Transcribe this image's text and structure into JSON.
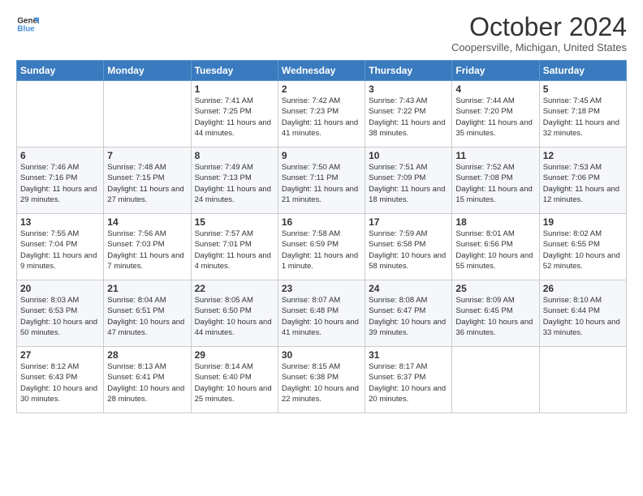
{
  "logo": {
    "line1": "General",
    "line2": "Blue"
  },
  "title": "October 2024",
  "location": "Coopersville, Michigan, United States",
  "days_of_week": [
    "Sunday",
    "Monday",
    "Tuesday",
    "Wednesday",
    "Thursday",
    "Friday",
    "Saturday"
  ],
  "weeks": [
    [
      {
        "day": "",
        "sunrise": "",
        "sunset": "",
        "daylight": ""
      },
      {
        "day": "",
        "sunrise": "",
        "sunset": "",
        "daylight": ""
      },
      {
        "day": "1",
        "sunrise": "Sunrise: 7:41 AM",
        "sunset": "Sunset: 7:25 PM",
        "daylight": "Daylight: 11 hours and 44 minutes."
      },
      {
        "day": "2",
        "sunrise": "Sunrise: 7:42 AM",
        "sunset": "Sunset: 7:23 PM",
        "daylight": "Daylight: 11 hours and 41 minutes."
      },
      {
        "day": "3",
        "sunrise": "Sunrise: 7:43 AM",
        "sunset": "Sunset: 7:22 PM",
        "daylight": "Daylight: 11 hours and 38 minutes."
      },
      {
        "day": "4",
        "sunrise": "Sunrise: 7:44 AM",
        "sunset": "Sunset: 7:20 PM",
        "daylight": "Daylight: 11 hours and 35 minutes."
      },
      {
        "day": "5",
        "sunrise": "Sunrise: 7:45 AM",
        "sunset": "Sunset: 7:18 PM",
        "daylight": "Daylight: 11 hours and 32 minutes."
      }
    ],
    [
      {
        "day": "6",
        "sunrise": "Sunrise: 7:46 AM",
        "sunset": "Sunset: 7:16 PM",
        "daylight": "Daylight: 11 hours and 29 minutes."
      },
      {
        "day": "7",
        "sunrise": "Sunrise: 7:48 AM",
        "sunset": "Sunset: 7:15 PM",
        "daylight": "Daylight: 11 hours and 27 minutes."
      },
      {
        "day": "8",
        "sunrise": "Sunrise: 7:49 AM",
        "sunset": "Sunset: 7:13 PM",
        "daylight": "Daylight: 11 hours and 24 minutes."
      },
      {
        "day": "9",
        "sunrise": "Sunrise: 7:50 AM",
        "sunset": "Sunset: 7:11 PM",
        "daylight": "Daylight: 11 hours and 21 minutes."
      },
      {
        "day": "10",
        "sunrise": "Sunrise: 7:51 AM",
        "sunset": "Sunset: 7:09 PM",
        "daylight": "Daylight: 11 hours and 18 minutes."
      },
      {
        "day": "11",
        "sunrise": "Sunrise: 7:52 AM",
        "sunset": "Sunset: 7:08 PM",
        "daylight": "Daylight: 11 hours and 15 minutes."
      },
      {
        "day": "12",
        "sunrise": "Sunrise: 7:53 AM",
        "sunset": "Sunset: 7:06 PM",
        "daylight": "Daylight: 11 hours and 12 minutes."
      }
    ],
    [
      {
        "day": "13",
        "sunrise": "Sunrise: 7:55 AM",
        "sunset": "Sunset: 7:04 PM",
        "daylight": "Daylight: 11 hours and 9 minutes."
      },
      {
        "day": "14",
        "sunrise": "Sunrise: 7:56 AM",
        "sunset": "Sunset: 7:03 PM",
        "daylight": "Daylight: 11 hours and 7 minutes."
      },
      {
        "day": "15",
        "sunrise": "Sunrise: 7:57 AM",
        "sunset": "Sunset: 7:01 PM",
        "daylight": "Daylight: 11 hours and 4 minutes."
      },
      {
        "day": "16",
        "sunrise": "Sunrise: 7:58 AM",
        "sunset": "Sunset: 6:59 PM",
        "daylight": "Daylight: 11 hours and 1 minute."
      },
      {
        "day": "17",
        "sunrise": "Sunrise: 7:59 AM",
        "sunset": "Sunset: 6:58 PM",
        "daylight": "Daylight: 10 hours and 58 minutes."
      },
      {
        "day": "18",
        "sunrise": "Sunrise: 8:01 AM",
        "sunset": "Sunset: 6:56 PM",
        "daylight": "Daylight: 10 hours and 55 minutes."
      },
      {
        "day": "19",
        "sunrise": "Sunrise: 8:02 AM",
        "sunset": "Sunset: 6:55 PM",
        "daylight": "Daylight: 10 hours and 52 minutes."
      }
    ],
    [
      {
        "day": "20",
        "sunrise": "Sunrise: 8:03 AM",
        "sunset": "Sunset: 6:53 PM",
        "daylight": "Daylight: 10 hours and 50 minutes."
      },
      {
        "day": "21",
        "sunrise": "Sunrise: 8:04 AM",
        "sunset": "Sunset: 6:51 PM",
        "daylight": "Daylight: 10 hours and 47 minutes."
      },
      {
        "day": "22",
        "sunrise": "Sunrise: 8:05 AM",
        "sunset": "Sunset: 6:50 PM",
        "daylight": "Daylight: 10 hours and 44 minutes."
      },
      {
        "day": "23",
        "sunrise": "Sunrise: 8:07 AM",
        "sunset": "Sunset: 6:48 PM",
        "daylight": "Daylight: 10 hours and 41 minutes."
      },
      {
        "day": "24",
        "sunrise": "Sunrise: 8:08 AM",
        "sunset": "Sunset: 6:47 PM",
        "daylight": "Daylight: 10 hours and 39 minutes."
      },
      {
        "day": "25",
        "sunrise": "Sunrise: 8:09 AM",
        "sunset": "Sunset: 6:45 PM",
        "daylight": "Daylight: 10 hours and 36 minutes."
      },
      {
        "day": "26",
        "sunrise": "Sunrise: 8:10 AM",
        "sunset": "Sunset: 6:44 PM",
        "daylight": "Daylight: 10 hours and 33 minutes."
      }
    ],
    [
      {
        "day": "27",
        "sunrise": "Sunrise: 8:12 AM",
        "sunset": "Sunset: 6:43 PM",
        "daylight": "Daylight: 10 hours and 30 minutes."
      },
      {
        "day": "28",
        "sunrise": "Sunrise: 8:13 AM",
        "sunset": "Sunset: 6:41 PM",
        "daylight": "Daylight: 10 hours and 28 minutes."
      },
      {
        "day": "29",
        "sunrise": "Sunrise: 8:14 AM",
        "sunset": "Sunset: 6:40 PM",
        "daylight": "Daylight: 10 hours and 25 minutes."
      },
      {
        "day": "30",
        "sunrise": "Sunrise: 8:15 AM",
        "sunset": "Sunset: 6:38 PM",
        "daylight": "Daylight: 10 hours and 22 minutes."
      },
      {
        "day": "31",
        "sunrise": "Sunrise: 8:17 AM",
        "sunset": "Sunset: 6:37 PM",
        "daylight": "Daylight: 10 hours and 20 minutes."
      },
      {
        "day": "",
        "sunrise": "",
        "sunset": "",
        "daylight": ""
      },
      {
        "day": "",
        "sunrise": "",
        "sunset": "",
        "daylight": ""
      }
    ]
  ]
}
